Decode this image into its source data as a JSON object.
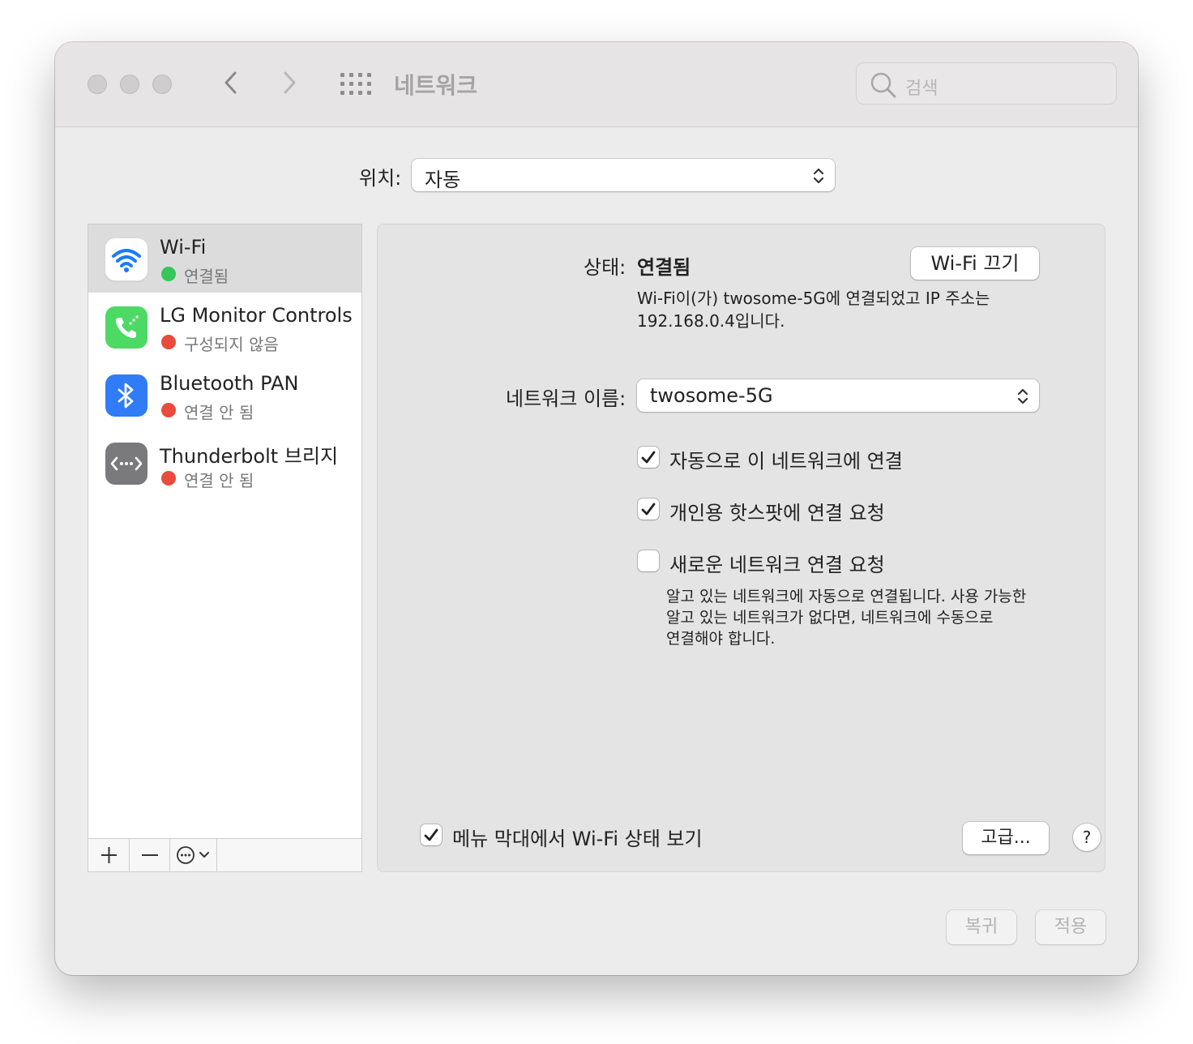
{
  "window": {
    "title": "네트워크"
  },
  "search": {
    "placeholder": "검색"
  },
  "location": {
    "label": "위치:",
    "value": "자동"
  },
  "services": [
    {
      "name": "Wi-Fi",
      "status": "연결됨",
      "status_color": "#34c759",
      "icon": "wifi-icon",
      "selected": true
    },
    {
      "name": "LG Monitor Controls",
      "status": "구성되지 않음",
      "status_color": "#e94b3c",
      "icon": "phone-icon"
    },
    {
      "name": "Bluetooth PAN",
      "status": "연결 안 됨",
      "status_color": "#e94b3c",
      "icon": "bluetooth-icon"
    },
    {
      "name": "Thunderbolt 브리지",
      "status": "연결 안 됨",
      "status_color": "#e94b3c",
      "icon": "thunderbolt-bridge-icon"
    }
  ],
  "sidebar_tools": {
    "add": "+",
    "remove": "—",
    "more": "⋯"
  },
  "detail": {
    "status_label": "상태:",
    "status_value": "연결됨",
    "wifi_off_button": "Wi-Fi 끄기",
    "status_desc_line1": "Wi-Fi이(가) twosome-5G에 연결되었고 IP 주소는",
    "status_desc_line2": "192.168.0.4입니다.",
    "network_name_label": "네트워크 이름:",
    "network_name_value": "twosome-5G",
    "checkboxes": [
      {
        "label": "자동으로 이 네트워크에 연결",
        "checked": true
      },
      {
        "label": "개인용 핫스팟에 연결 요청",
        "checked": true
      },
      {
        "label": "새로운 네트워크 연결 요청",
        "checked": false
      }
    ],
    "note_line1": "알고 있는 네트워크에 자동으로 연결됩니다. 사용 가능한",
    "note_line2": "알고 있는 네트워크가 없다면, 네트워크에 수동으로",
    "note_line3": "연결해야 합니다.",
    "menubar_checkbox": {
      "label": "메뉴 막대에서 Wi-Fi 상태 보기",
      "checked": true
    },
    "advanced_button": "고급...",
    "help_button": "?"
  },
  "footer": {
    "revert_button": "복귀",
    "apply_button": "적용"
  }
}
